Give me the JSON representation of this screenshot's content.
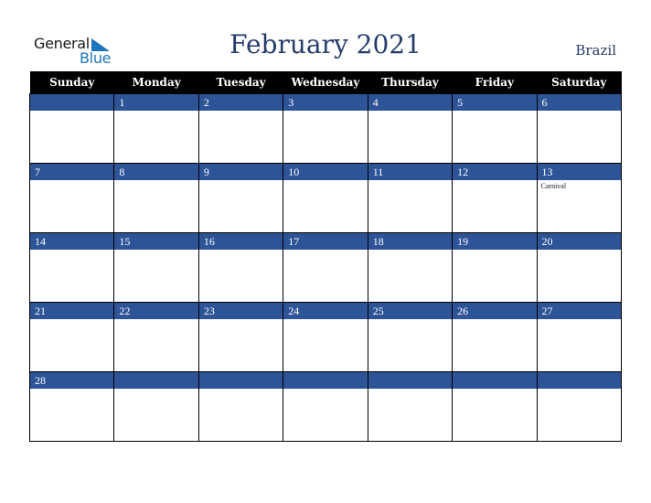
{
  "logo": {
    "line1": "General",
    "line2": "Blue"
  },
  "header": {
    "title": "February 2021",
    "country": "Brazil"
  },
  "colors": {
    "band": "#2d5496",
    "title": "#253d6b",
    "header_bg": "#000000",
    "logo_blue": "#1b75bc"
  },
  "weekdays": [
    "Sunday",
    "Monday",
    "Tuesday",
    "Wednesday",
    "Thursday",
    "Friday",
    "Saturday"
  ],
  "weeks": [
    [
      {
        "day": "",
        "event": ""
      },
      {
        "day": "1",
        "event": ""
      },
      {
        "day": "2",
        "event": ""
      },
      {
        "day": "3",
        "event": ""
      },
      {
        "day": "4",
        "event": ""
      },
      {
        "day": "5",
        "event": ""
      },
      {
        "day": "6",
        "event": ""
      }
    ],
    [
      {
        "day": "7",
        "event": ""
      },
      {
        "day": "8",
        "event": ""
      },
      {
        "day": "9",
        "event": ""
      },
      {
        "day": "10",
        "event": ""
      },
      {
        "day": "11",
        "event": ""
      },
      {
        "day": "12",
        "event": ""
      },
      {
        "day": "13",
        "event": "Carnival"
      }
    ],
    [
      {
        "day": "14",
        "event": ""
      },
      {
        "day": "15",
        "event": ""
      },
      {
        "day": "16",
        "event": ""
      },
      {
        "day": "17",
        "event": ""
      },
      {
        "day": "18",
        "event": ""
      },
      {
        "day": "19",
        "event": ""
      },
      {
        "day": "20",
        "event": ""
      }
    ],
    [
      {
        "day": "21",
        "event": ""
      },
      {
        "day": "22",
        "event": ""
      },
      {
        "day": "23",
        "event": ""
      },
      {
        "day": "24",
        "event": ""
      },
      {
        "day": "25",
        "event": ""
      },
      {
        "day": "26",
        "event": ""
      },
      {
        "day": "27",
        "event": ""
      }
    ],
    [
      {
        "day": "28",
        "event": ""
      },
      {
        "day": "",
        "event": ""
      },
      {
        "day": "",
        "event": ""
      },
      {
        "day": "",
        "event": ""
      },
      {
        "day": "",
        "event": ""
      },
      {
        "day": "",
        "event": ""
      },
      {
        "day": "",
        "event": ""
      }
    ]
  ]
}
